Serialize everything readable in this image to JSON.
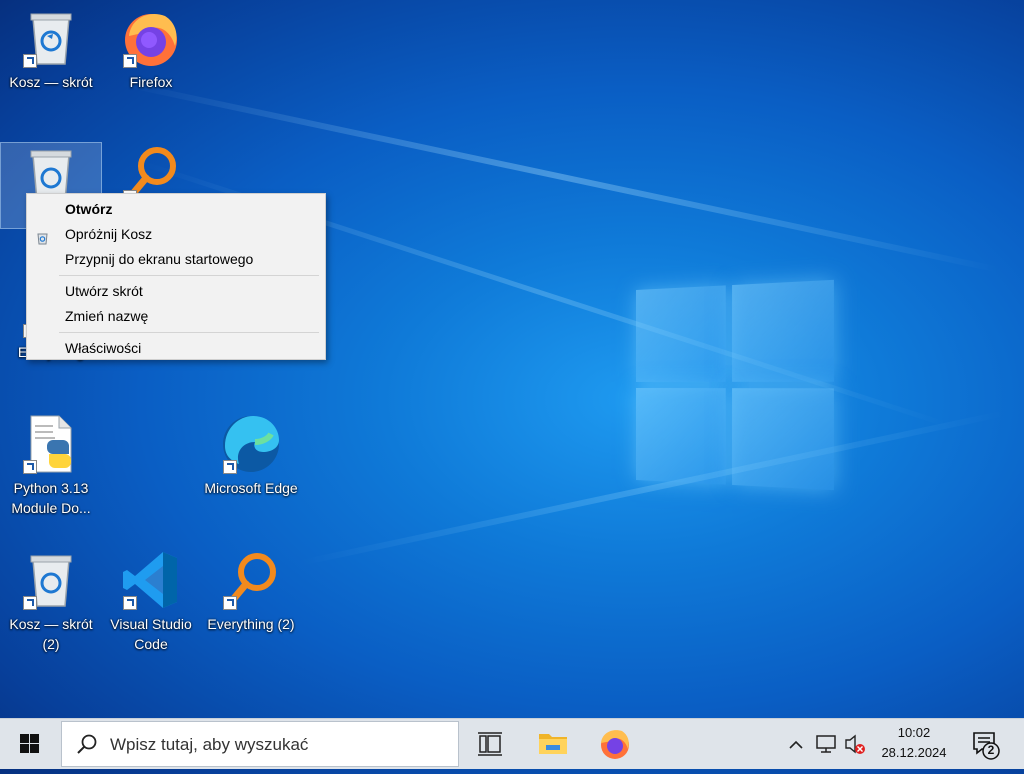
{
  "desktop": {
    "icons": [
      {
        "label": "Kosz — skrót",
        "icon": "recycle-bin-icon"
      },
      {
        "label": "Firefox",
        "icon": "firefox-icon"
      },
      {
        "label": "",
        "icon": "recycle-bin-icon"
      },
      {
        "label": "",
        "icon": "everything-icon"
      },
      {
        "label": "Everything",
        "icon": "everything-icon"
      },
      {
        "label": "Python 3.13 Module Do...",
        "icon": "python-docs-icon"
      },
      {
        "label": "Microsoft Edge",
        "icon": "edge-icon"
      },
      {
        "label": "Kosz — skrót (2)",
        "icon": "recycle-bin-icon"
      },
      {
        "label": "Visual Studio Code",
        "icon": "vscode-icon"
      },
      {
        "label": "Everything (2)",
        "icon": "everything-icon"
      }
    ]
  },
  "context_menu": {
    "open": "Otwórz",
    "empty_bin": "Opróżnij Kosz",
    "pin_start": "Przypnij do ekranu startowego",
    "create_shortcut": "Utwórz skrót",
    "rename": "Zmień nazwę",
    "properties": "Właściwości"
  },
  "taskbar": {
    "search_placeholder": "Wpisz tutaj, aby wyszukać",
    "time": "10:02",
    "date": "28.12.2024",
    "notification_count": "2"
  },
  "colors": {
    "accent": "#0a5ec4",
    "taskbar_bg": "#dfe4ea",
    "menu_bg": "#f2f2f2"
  }
}
